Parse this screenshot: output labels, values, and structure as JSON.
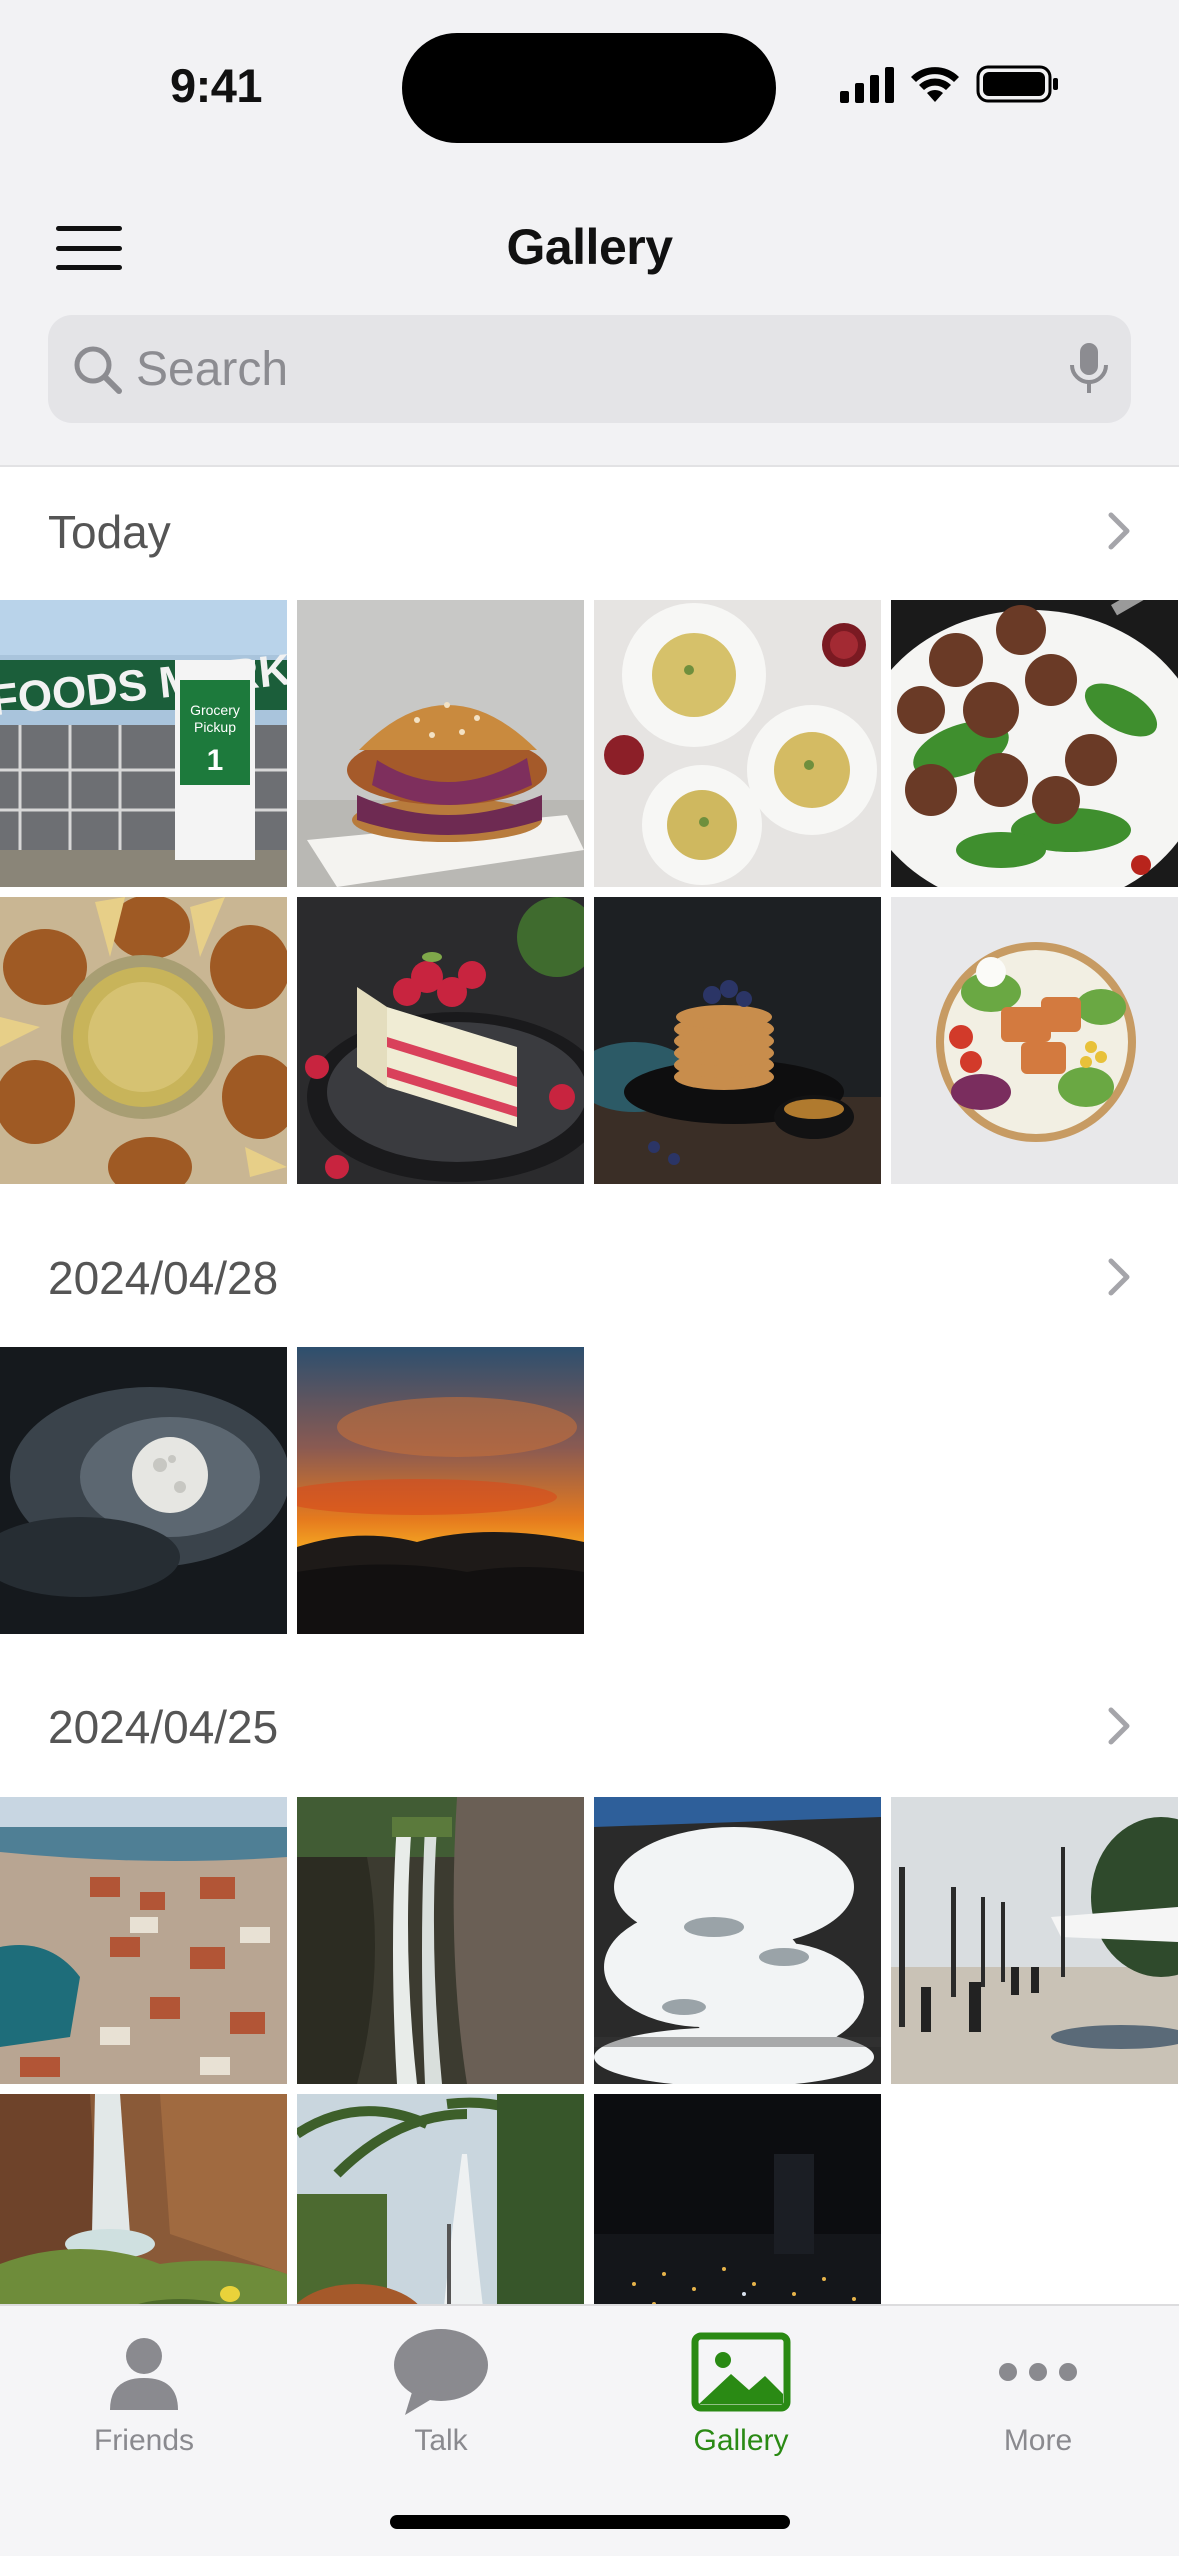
{
  "status_bar": {
    "time": "9:41"
  },
  "nav": {
    "title": "Gallery"
  },
  "search": {
    "placeholder": "Search"
  },
  "sections": [
    {
      "title": "Today",
      "photos": [
        "grocery-market",
        "fried-chicken-burger",
        "spaghetti-dishes",
        "meatballs-salad",
        "croquettes-sauce",
        "raspberry-cake",
        "pancakes",
        "salmon-bowl"
      ]
    },
    {
      "title": "2024/04/28",
      "photos": [
        "full-moon-clouds",
        "sunset-sky"
      ]
    },
    {
      "title": "2024/04/25",
      "photos": [
        "coastal-town-aerial",
        "canyon-waterfall",
        "rushing-waterfall",
        "seaside-promenade",
        "cliff-waterfall",
        "garden-fountain",
        "city-night"
      ]
    }
  ],
  "tabs": [
    {
      "label": "Friends",
      "icon": "person-icon"
    },
    {
      "label": "Talk",
      "icon": "chat-bubble-icon"
    },
    {
      "label": "Gallery",
      "icon": "photo-icon",
      "active": true
    },
    {
      "label": "More",
      "icon": "more-dots-icon"
    }
  ],
  "colors": {
    "accent": "#2a8a14",
    "header_bg": "#f2f2f4",
    "search_bg": "#e4e4e7",
    "inactive": "#8a8a8f"
  }
}
